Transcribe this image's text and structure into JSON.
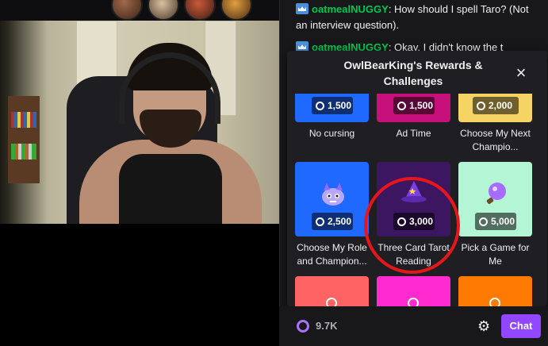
{
  "chat_messages": [
    {
      "user": "oatmealNUGGY",
      "text": ": How should I spell Taro? (Not an interview question)."
    },
    {
      "user": "oatmealNUGGY",
      "text": ": Okay, I didn't know the t"
    }
  ],
  "popover": {
    "title": "OwlBearKing's Rewards & Challenges",
    "close_icon": "×"
  },
  "rewards": [
    {
      "cost": "1,500",
      "label": "No cursing",
      "color": "#1f69ff"
    },
    {
      "cost": "1,500",
      "label": "Ad Time",
      "color": "#c8107a"
    },
    {
      "cost": "2,000",
      "label": "Choose My Next Champio...",
      "color": "#f6d365"
    },
    {
      "cost": "2,500",
      "label": "Choose My Role and Champion...",
      "color": "#1f69ff",
      "icon": "creature-icon"
    },
    {
      "cost": "3,000",
      "label": "Three Card Tarot Reading",
      "color": "#3c1660",
      "icon": "wizard-hat-icon"
    },
    {
      "cost": "5,000",
      "label": "Pick a Game for Me",
      "color": "#b3f5d4",
      "icon": "potion-icon"
    },
    {
      "color": "#ff6363"
    },
    {
      "color": "#ff2bd1"
    },
    {
      "color": "#ff7a00"
    }
  ],
  "bottom_bar": {
    "points": "9.7K",
    "chat_button": "Chat"
  }
}
